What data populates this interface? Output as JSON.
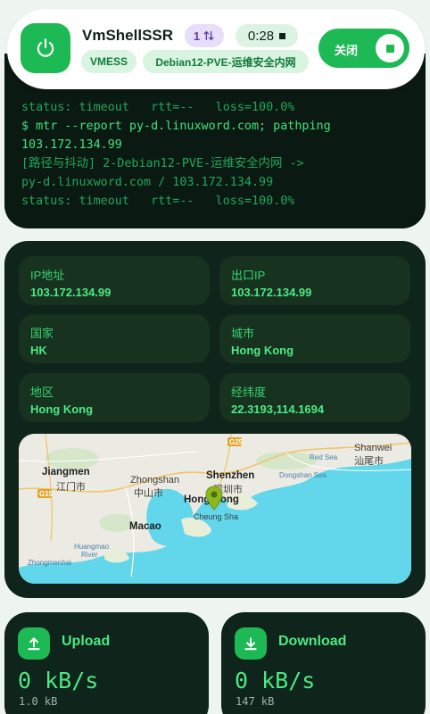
{
  "header": {
    "app_title": "VmShellSSR",
    "count_badge": "1",
    "timer": "0:28",
    "protocol": "VMESS",
    "node_name": "Debian12-PVE-运维安全内网",
    "toggle_label": "关闭",
    "accent": "#1db954"
  },
  "terminal": {
    "lines": [
      "status: timeout   rtt=--   loss=100.0%",
      "$ mtr --report py-d.linuxword.com; pathping",
      "103.172.134.99",
      "[路径与抖动] 2-Debian12-PVE-运维安全内网 ->",
      "py-d.linuxword.com / 103.172.134.99",
      "status: timeout   rtt=--   loss=100.0%"
    ]
  },
  "info": {
    "ip_label": "IP地址",
    "ip_value": "103.172.134.99",
    "exit_ip_label": "出口IP",
    "exit_ip_value": "103.172.134.99",
    "country_label": "国家",
    "country_value": "HK",
    "city_label": "城市",
    "city_value": "Hong Kong",
    "region_label": "地区",
    "region_value": "Hong Kong",
    "coords_label": "经纬度",
    "coords_value": "22.3193,114.1694"
  },
  "map": {
    "labels": {
      "jiangmen": "Jiangmen",
      "jiangmen_cn": "江门市",
      "zhongshan": "Zhongshan",
      "zhongshan_cn": "中山市",
      "shenzhen": "Shenzhen",
      "shenzhen_cn": "深圳市",
      "hongkong": "Hong Kong",
      "macao": "Macao",
      "cheung_sha": "Cheung Sha",
      "shanwei": "Shanwei",
      "shanwei_cn": "汕尾市",
      "red_sea": "Red Sea",
      "dongshan_sea": "Dongshan Sea",
      "huangmao": "Huangmao",
      "river": "River",
      "zhongmenhai": "Zhongmenhai",
      "g15": "G15",
      "g25": "G25"
    },
    "water_color": "#62d6ea"
  },
  "upload": {
    "title": "Upload",
    "speed": "0 kB/s",
    "total": "1.0 kB"
  },
  "download": {
    "title": "Download",
    "speed": "0 kB/s",
    "total": "147 kB"
  }
}
